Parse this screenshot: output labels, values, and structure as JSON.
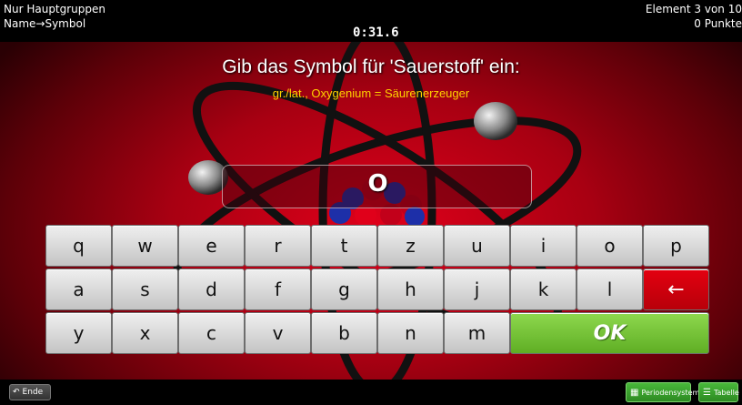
{
  "header": {
    "mode_line1": "Nur Hauptgruppen",
    "mode_line2": "Name→Symbol",
    "timer": "0:31.6",
    "progress": "Element 3 von 10",
    "points": "0 Punkte"
  },
  "question": {
    "prompt": "Gib das Symbol für 'Sauerstoff' ein:",
    "hint": "gr./lat., Oxygenium = Säurenerzeuger"
  },
  "answer": {
    "value": "O"
  },
  "keyboard": {
    "row1": [
      "q",
      "w",
      "e",
      "r",
      "t",
      "z",
      "u",
      "i",
      "o",
      "p"
    ],
    "row2": [
      "a",
      "s",
      "d",
      "f",
      "g",
      "h",
      "j",
      "k",
      "l"
    ],
    "row3": [
      "y",
      "x",
      "c",
      "v",
      "b",
      "n",
      "m"
    ],
    "backspace_label": "←",
    "ok_label": "OK"
  },
  "footer": {
    "end_label": "Ende",
    "end_icon": "undo-arrow-icon",
    "periodic_label": "Periodensystem",
    "periodic_icon": "grid-icon",
    "table_label": "Tabelle",
    "table_icon": "list-icon"
  },
  "colors": {
    "background": "#a80012",
    "hint": "#ffd200",
    "backspace": "#d4000e",
    "ok": "#76c43a"
  }
}
